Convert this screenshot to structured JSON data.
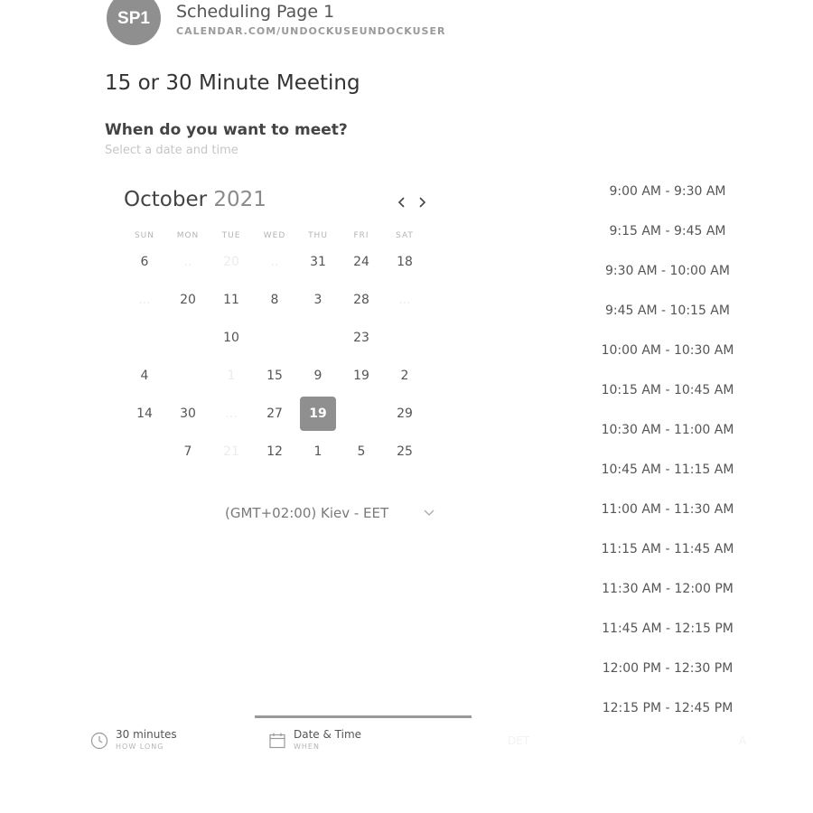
{
  "header": {
    "avatar_initials": "SP1",
    "page_name": "Scheduling Page 1",
    "page_url": "CALENDAR.COM/UNDOCKUSEUNDOCKUSER"
  },
  "meeting": {
    "title": "15 or 30 Minute Meeting",
    "question": "When do you want to meet?",
    "hint": "Select a date and time"
  },
  "calendar": {
    "month": "October",
    "year": "2021",
    "prev_icon": "chevron-left-icon",
    "next_icon": "chevron-right-icon",
    "weekdays": [
      "SUN",
      "MON",
      "TUE",
      "WED",
      "THU",
      "FRI",
      "SAT"
    ],
    "weeks": [
      [
        {
          "d": "6"
        },
        {
          "d": "..",
          "faint": true
        },
        {
          "d": "20",
          "faint": true
        },
        {
          "d": "..",
          "faint": true
        },
        {
          "d": "31"
        },
        {
          "d": "24"
        },
        {
          "d": "18"
        }
      ],
      [
        {
          "d": "...",
          "faint": true
        },
        {
          "d": "20"
        },
        {
          "d": "11"
        },
        {
          "d": "8"
        },
        {
          "d": "3"
        },
        {
          "d": "28"
        },
        {
          "d": "...",
          "faint": true
        }
      ],
      [
        {
          "d": ""
        },
        {
          "d": ""
        },
        {
          "d": "10"
        },
        {
          "d": ""
        },
        {
          "d": ""
        },
        {
          "d": "23"
        },
        {
          "d": ""
        }
      ],
      [
        {
          "d": "4"
        },
        {
          "d": ""
        },
        {
          "d": "1",
          "faint": true
        },
        {
          "d": "15"
        },
        {
          "d": "9"
        },
        {
          "d": "19"
        },
        {
          "d": "2"
        }
      ],
      [
        {
          "d": "14"
        },
        {
          "d": "30"
        },
        {
          "d": "...",
          "faint": true
        },
        {
          "d": "27"
        },
        {
          "d": "19",
          "selected": true
        },
        {
          "d": ""
        },
        {
          "d": "29"
        }
      ],
      [
        {
          "d": ""
        },
        {
          "d": "7"
        },
        {
          "d": "21",
          "faint": true
        },
        {
          "d": "12"
        },
        {
          "d": "1"
        },
        {
          "d": "5"
        },
        {
          "d": "25"
        }
      ]
    ]
  },
  "timezone": {
    "value": "(GMT+02:00) Kiev - EET",
    "icon": "chevron-down-icon"
  },
  "time_slots": [
    "9:00 AM - 9:30 AM",
    "9:15 AM - 9:45 AM",
    "9:30 AM - 10:00 AM",
    "9:45 AM - 10:15 AM",
    "10:00 AM - 10:30 AM",
    "10:15 AM - 10:45 AM",
    "10:30 AM - 11:00 AM",
    "10:45 AM - 11:15 AM",
    "11:00 AM - 11:30 AM",
    "11:15 AM - 11:45 AM",
    "11:30 AM - 12:00 PM",
    "11:45 AM - 12:15 PM",
    "12:00 PM - 12:30 PM",
    "12:15 PM - 12:45 PM"
  ],
  "steps": {
    "duration": {
      "label": "30 minutes",
      "sub": "HOW LONG",
      "icon": "clock-icon"
    },
    "date_time": {
      "label": "Date & Time",
      "sub": "WHEN",
      "icon": "calendar-icon"
    },
    "ghost_left": "DET",
    "ghost_right": "A"
  },
  "colors": {
    "avatar": "#8f8f8f",
    "selected_day": "#8f8f8f",
    "active_step_rule": "#999999"
  }
}
